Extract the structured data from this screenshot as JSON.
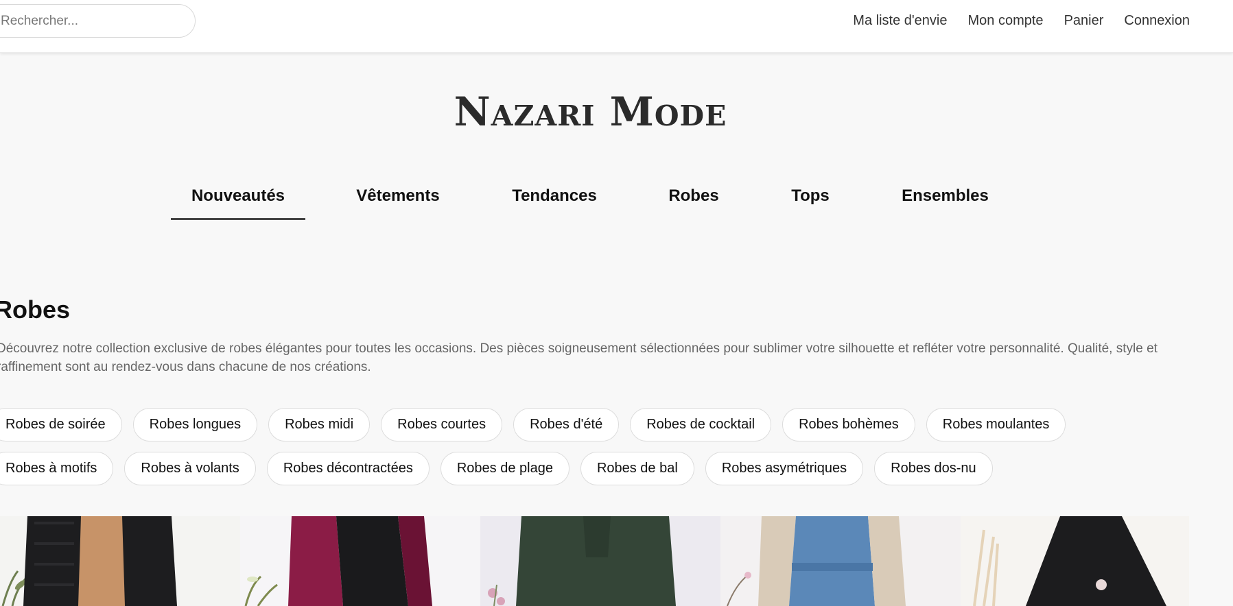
{
  "search": {
    "placeholder": "Rechercher..."
  },
  "topnav": {
    "wishlist": "Ma liste d'envie",
    "account": "Mon compte",
    "cart": "Panier",
    "login": "Connexion"
  },
  "brand": {
    "name": "Nazari Mode"
  },
  "categories": [
    {
      "label": "Nouveautés",
      "active": true
    },
    {
      "label": "Vêtements",
      "active": false
    },
    {
      "label": "Tendances",
      "active": false
    },
    {
      "label": "Robes",
      "active": false
    },
    {
      "label": "Tops",
      "active": false
    },
    {
      "label": "Ensembles",
      "active": false
    }
  ],
  "section": {
    "title": "Robes",
    "description": "Découvrez notre collection exclusive de robes élégantes pour toutes les occasions. Des pièces soigneusement sélectionnées pour sublimer votre silhouette et refléter votre personnalité. Qualité, style et raffinement sont au rendez-vous dans chacune de nos créations."
  },
  "filters": {
    "row1": [
      "Robes de soirée",
      "Robes longues",
      "Robes midi",
      "Robes courtes",
      "Robes d'été",
      "Robes de cocktail",
      "Robes bohèmes",
      "Robes moulantes"
    ],
    "row2": [
      "Robes à motifs",
      "Robes à volants",
      "Robes décontractées",
      "Robes de plage",
      "Robes de bal",
      "Robes asymétriques",
      "Robes dos-nu"
    ]
  },
  "products": [
    {
      "image": "black-cardigan-over-camel",
      "colors": {
        "bg": "#f4f4f2",
        "main": "#1d1d1f",
        "accent": "#c79368"
      }
    },
    {
      "image": "burgundy-jacket-over-black",
      "colors": {
        "bg": "#f6f5f7",
        "main": "#8b1c46",
        "accent": "#1a1a1c"
      }
    },
    {
      "image": "dark-green-dress",
      "colors": {
        "bg": "#eceaf0",
        "main": "#344537",
        "accent": "#d8a3b8"
      }
    },
    {
      "image": "blue-dress-beige-cardigan",
      "colors": {
        "bg": "#f3f1f2",
        "main": "#5b88b8",
        "accent": "#d9cbb8"
      }
    },
    {
      "image": "black-hijab-dress",
      "colors": {
        "bg": "#f6f4f1",
        "main": "#1c1c1e",
        "accent": "#e5d3b8"
      }
    }
  ]
}
